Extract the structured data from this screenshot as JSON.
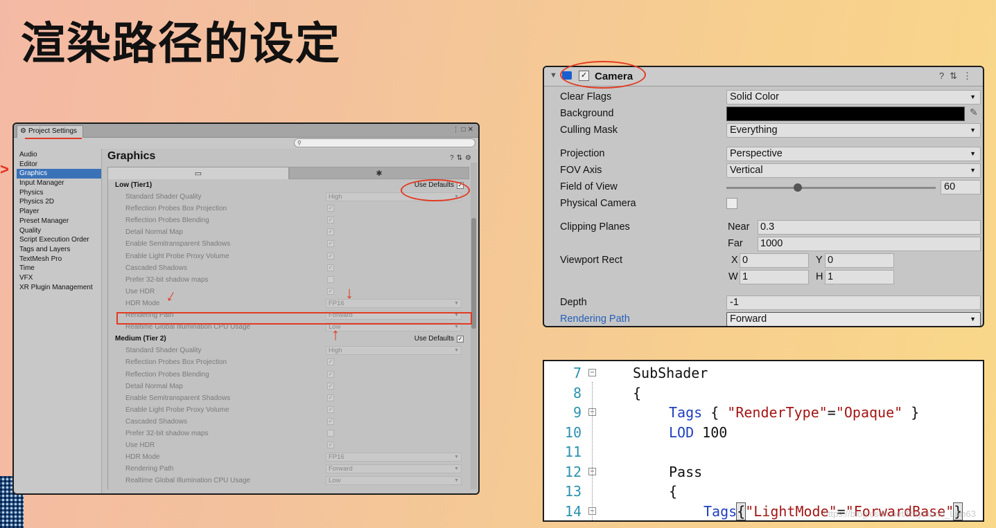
{
  "slide": {
    "title": "渲染路径的设定"
  },
  "project_settings": {
    "tab_label": "Project Settings",
    "search_placeholder": "",
    "sidebar": [
      "Audio",
      "Editor",
      "Graphics",
      "Input Manager",
      "Physics",
      "Physics 2D",
      "Player",
      "Preset Manager",
      "Quality",
      "Script Execution Order",
      "Tags and Layers",
      "TextMesh Pro",
      "Time",
      "VFX",
      "XR Plugin Management"
    ],
    "selected_item": "Graphics",
    "heading": "Graphics",
    "use_defaults_label": "Use Defaults",
    "tiers": [
      {
        "name": "Low (Tier1)",
        "rows": [
          {
            "label": "Standard Shader Quality",
            "type": "dropdown",
            "value": "High"
          },
          {
            "label": "Reflection Probes Box Projection",
            "type": "check",
            "value": "✓"
          },
          {
            "label": "Reflection Probes Blending",
            "type": "check",
            "value": "✓"
          },
          {
            "label": "Detail Normal Map",
            "type": "check",
            "value": "✓"
          },
          {
            "label": "Enable Semitransparent Shadows",
            "type": "check",
            "value": "✓"
          },
          {
            "label": "Enable Light Probe Proxy Volume",
            "type": "check",
            "value": "✓"
          },
          {
            "label": "Cascaded Shadows",
            "type": "check",
            "value": "✓"
          },
          {
            "label": "Prefer 32-bit shadow maps",
            "type": "check",
            "value": ""
          },
          {
            "label": "Use HDR",
            "type": "check",
            "value": "✓"
          },
          {
            "label": "HDR Mode",
            "type": "dropdown",
            "value": "FP16"
          },
          {
            "label": "Rendering Path",
            "type": "dropdown",
            "value": "Forward"
          },
          {
            "label": "Realtime Global Illumination CPU Usage",
            "type": "dropdown",
            "value": "Low"
          }
        ]
      },
      {
        "name": "Medium (Tier 2)",
        "rows": [
          {
            "label": "Standard Shader Quality",
            "type": "dropdown",
            "value": "High"
          },
          {
            "label": "Reflection Probes Box Projection",
            "type": "check",
            "value": "✓"
          },
          {
            "label": "Reflection Probes Blending",
            "type": "check",
            "value": "✓"
          },
          {
            "label": "Detail Normal Map",
            "type": "check",
            "value": "✓"
          },
          {
            "label": "Enable Semitransparent Shadows",
            "type": "check",
            "value": "✓"
          },
          {
            "label": "Enable Light Probe Proxy Volume",
            "type": "check",
            "value": "✓"
          },
          {
            "label": "Cascaded Shadows",
            "type": "check",
            "value": "✓"
          },
          {
            "label": "Prefer 32-bit shadow maps",
            "type": "check",
            "value": ""
          },
          {
            "label": "Use HDR",
            "type": "check",
            "value": "✓"
          },
          {
            "label": "HDR Mode",
            "type": "dropdown",
            "value": "FP16"
          },
          {
            "label": "Rendering Path",
            "type": "dropdown",
            "value": "Forward"
          },
          {
            "label": "Realtime Global Illumination CPU Usage",
            "type": "dropdown",
            "value": "Low"
          }
        ]
      }
    ]
  },
  "camera": {
    "title": "Camera",
    "enabled_check": "✓",
    "clear_flags": {
      "label": "Clear Flags",
      "value": "Solid Color"
    },
    "background": {
      "label": "Background",
      "color": "#000000"
    },
    "culling_mask": {
      "label": "Culling Mask",
      "value": "Everything"
    },
    "projection": {
      "label": "Projection",
      "value": "Perspective"
    },
    "fov_axis": {
      "label": "FOV Axis",
      "value": "Vertical"
    },
    "field_of_view": {
      "label": "Field of View",
      "value": "60"
    },
    "physical_camera": {
      "label": "Physical Camera"
    },
    "clipping_planes": {
      "label": "Clipping Planes",
      "near_label": "Near",
      "near": "0.3",
      "far_label": "Far",
      "far": "1000"
    },
    "viewport_rect": {
      "label": "Viewport Rect",
      "x_label": "X",
      "x": "0",
      "y_label": "Y",
      "y": "0",
      "w_label": "W",
      "w": "1",
      "h_label": "H",
      "h": "1"
    },
    "depth": {
      "label": "Depth",
      "value": "-1"
    },
    "rendering_path": {
      "label": "Rendering Path",
      "value": "Forward"
    }
  },
  "code": {
    "lines": [
      {
        "n": "7",
        "fold": true
      },
      {
        "n": "8",
        "fold": false
      },
      {
        "n": "9",
        "fold": true
      },
      {
        "n": "10",
        "fold": false
      },
      {
        "n": "11",
        "fold": false
      },
      {
        "n": "12",
        "fold": true
      },
      {
        "n": "13",
        "fold": false
      },
      {
        "n": "14",
        "fold": true
      }
    ],
    "subshader": "SubShader",
    "brace_open": "{",
    "tags_kw": "Tags",
    "tags_rest_a": " { ",
    "rendertype_key": "\"RenderType\"",
    "eq": "=",
    "rendertype_val": "\"Opaque\"",
    "tags_rest_b": " }",
    "lod_kw": "LOD",
    "lod_val": " 100",
    "pass_kw": "Pass",
    "lightmode_key": "\"LightMode\"",
    "lightmode_val": "\"ForwardBase\"",
    "brace_close": "}",
    "watermark": "https://blog.csdn.net/Raymond_Lilin63"
  }
}
